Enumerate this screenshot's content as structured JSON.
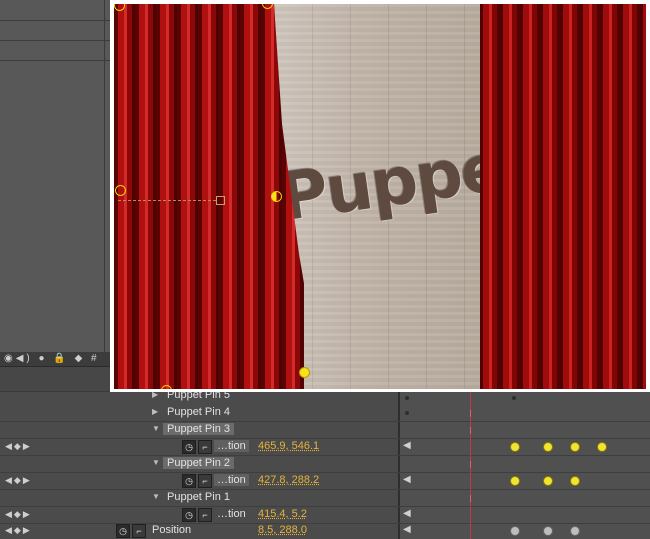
{
  "timeline": {
    "header_icons": "◉◀) ● 🔒 ◆ #",
    "rows": [
      {
        "label": "Puppet Pin 5"
      },
      {
        "label": "Puppet Pin 4"
      },
      {
        "label": "Puppet Pin 3",
        "prop_label": "…tion",
        "value": "465.9, 546.1"
      },
      {
        "label": "Puppet Pin 2",
        "prop_label": "…tion",
        "value": "427.8, 288.2"
      },
      {
        "label": "Puppet Pin 1",
        "prop_label": "…tion",
        "value": "415.4, 5.2"
      },
      {
        "label": "Position",
        "value": "8.5, 288.0"
      }
    ],
    "colors": {
      "accent_value": "#e6b33a",
      "keyframe": "#f0e432",
      "playhead": "#c43a3a"
    }
  },
  "viewer": {
    "text": "Puppe"
  }
}
